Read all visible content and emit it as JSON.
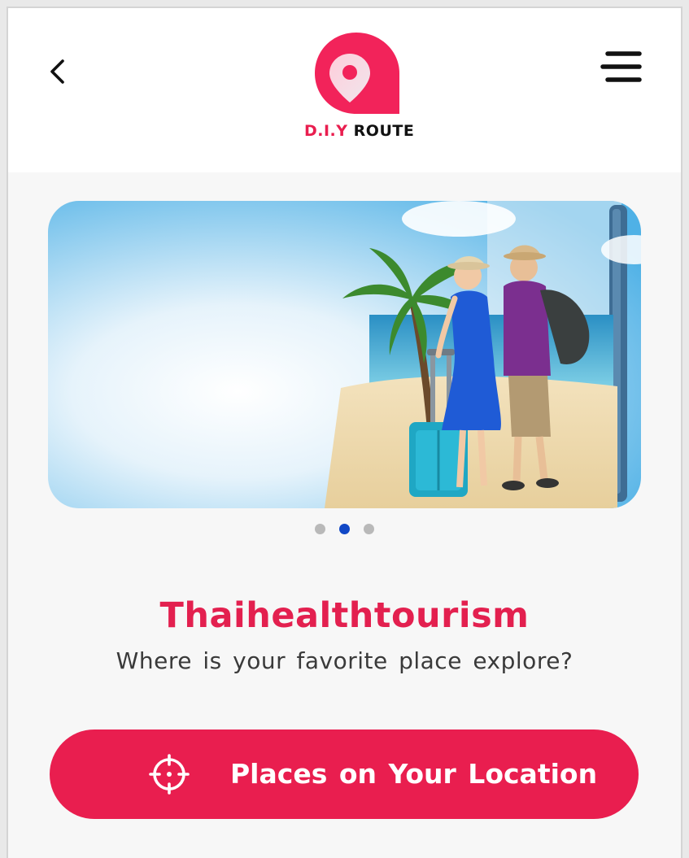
{
  "header": {
    "logo": {
      "prefix": "D.I.Y",
      "suffix": "ROUTE"
    },
    "back_icon": "chevron-left-icon",
    "menu_icon": "hamburger-menu-icon"
  },
  "carousel": {
    "slide_count": 3,
    "active_index": 1,
    "active_color": "#1148c6",
    "inactive_color": "#b9b9b9"
  },
  "hero": {
    "title": "Thaihealthtourism",
    "subtitle": "Where is your favorite place explore?"
  },
  "cta": {
    "label": "Places on Your Location",
    "icon": "crosshair-icon"
  },
  "colors": {
    "brand": "#e91e4f",
    "background": "#f7f7f7",
    "header": "#ffffff"
  }
}
